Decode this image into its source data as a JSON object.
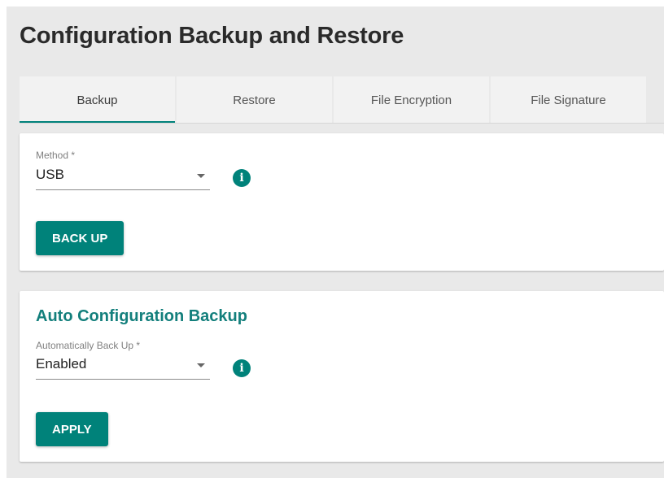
{
  "page": {
    "title": "Configuration Backup and Restore"
  },
  "tabs": [
    {
      "label": "Backup",
      "active": true
    },
    {
      "label": "Restore",
      "active": false
    },
    {
      "label": "File Encryption",
      "active": false
    },
    {
      "label": "File Signature",
      "active": false
    }
  ],
  "backup_card": {
    "method_label": "Method *",
    "method_value": "USB",
    "info_icon": "info-icon",
    "button_label": "BACK UP"
  },
  "auto_card": {
    "title": "Auto Configuration Backup",
    "auto_label": "Automatically Back Up *",
    "auto_value": "Enabled",
    "info_icon": "info-icon",
    "button_label": "APPLY"
  },
  "colors": {
    "accent": "#00827a",
    "background": "#e9e9e9",
    "card": "#ffffff",
    "section_title": "#137f7c"
  }
}
